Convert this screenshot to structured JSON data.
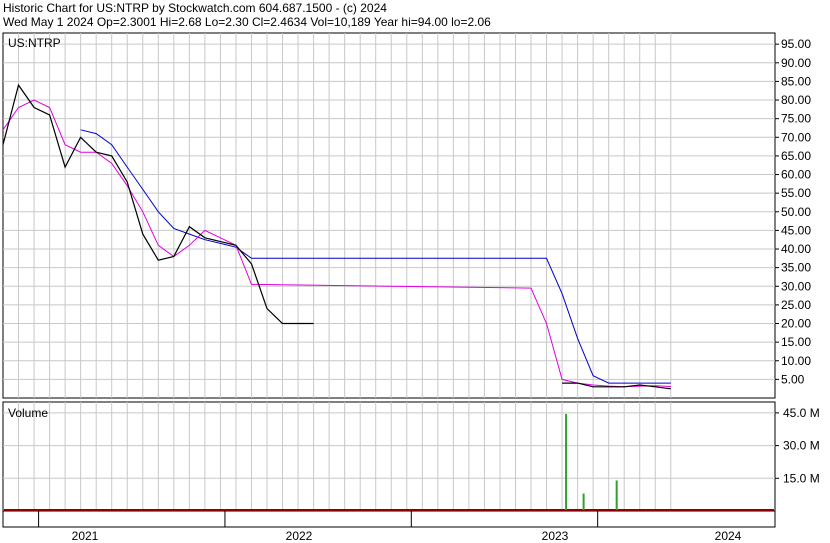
{
  "header": {
    "line1": "Historic Chart for US:NTRP by Stockwatch.com 604.687.1500 - (c) 2024",
    "line2": "Wed May  1 2024  Op=2.3001  Hi=2.68  Lo=2.30  Cl=2.4634  Vol=10,189  Year hi=94.00  lo=2.06"
  },
  "chart_data": [
    {
      "type": "line",
      "title": "US:NTRP",
      "ylim": [
        0,
        98
      ],
      "y_ticks": [
        "95.00",
        "90.00",
        "85.00",
        "80.00",
        "75.00",
        "70.00",
        "65.00",
        "60.00",
        "55.00",
        "50.00",
        "45.00",
        "40.00",
        "35.00",
        "30.00",
        "25.00",
        "20.00",
        "15.00",
        "10.00",
        "5.00"
      ],
      "x_ticks": [
        "2021",
        "2022",
        "2023",
        "2024"
      ],
      "grid": true,
      "colors": {
        "price": "#000000",
        "ma_short": "#e000e0",
        "ma_long": "#0000cc",
        "grid": "#c8c8c8"
      },
      "series": [
        {
          "key": "price",
          "x": [
            "2020-10",
            "2020-11",
            "2020-12",
            "2021-01",
            "2021-02",
            "2021-03",
            "2021-04",
            "2021-05",
            "2021-06",
            "2021-07",
            "2021-08",
            "2021-09",
            "2021-10",
            "2021-11",
            "2021-12",
            "2022-01",
            "2022-02",
            "2022-03",
            "2022-04",
            "2022-05",
            "2022-06",
            "2023-10",
            "2023-11",
            "2023-12",
            "2024-01",
            "2024-02",
            "2024-03",
            "2024-04",
            "2024-05"
          ],
          "y": [
            68,
            84,
            78,
            76,
            62,
            70,
            66,
            65,
            58,
            44,
            37,
            38,
            46,
            43,
            42,
            41,
            36,
            24,
            20,
            20,
            20,
            4,
            4,
            3,
            3,
            3,
            3.5,
            3,
            2.46
          ]
        },
        {
          "key": "ma_short",
          "x": [
            "2020-10",
            "2020-11",
            "2020-12",
            "2021-01",
            "2021-02",
            "2021-03",
            "2021-04",
            "2021-05",
            "2021-06",
            "2021-07",
            "2021-08",
            "2021-09",
            "2021-10",
            "2021-11",
            "2021-12",
            "2022-01",
            "2022-02",
            "2023-08",
            "2023-09",
            "2023-10",
            "2023-11",
            "2023-12",
            "2024-01",
            "2024-02",
            "2024-03",
            "2024-04",
            "2024-05"
          ],
          "y": [
            72,
            78,
            80,
            78,
            68,
            66,
            66,
            63,
            57,
            50,
            41,
            38,
            41,
            45,
            43,
            41,
            30.5,
            29.5,
            20,
            5,
            4,
            3.5,
            3.2,
            3,
            3.2,
            3.3,
            3.1
          ]
        },
        {
          "key": "ma_long",
          "x": [
            "2021-03",
            "2021-04",
            "2021-05",
            "2021-06",
            "2021-07",
            "2021-08",
            "2021-09",
            "2021-10",
            "2021-11",
            "2021-12",
            "2022-01",
            "2022-02",
            "2023-09",
            "2023-10",
            "2023-11",
            "2023-12",
            "2024-01",
            "2024-02",
            "2024-03",
            "2024-04",
            "2024-05"
          ],
          "y": [
            72,
            71,
            68,
            62,
            56,
            50,
            45.5,
            44,
            42.5,
            41.5,
            40.5,
            37.5,
            37.5,
            28,
            16,
            6,
            4,
            4,
            4,
            4,
            4
          ]
        }
      ]
    },
    {
      "type": "bar",
      "title": "Volume",
      "y_ticks": [
        "45.0 M",
        "30.0 M",
        "15.0 M"
      ],
      "ylim_millions": [
        0,
        50
      ],
      "colors": {
        "volume": "#2ea02e",
        "baseline": "#8b0000"
      },
      "x": [
        "2023-10",
        "2023-11",
        "2024-01"
      ],
      "values_millions": [
        44.5,
        8,
        14
      ]
    }
  ]
}
